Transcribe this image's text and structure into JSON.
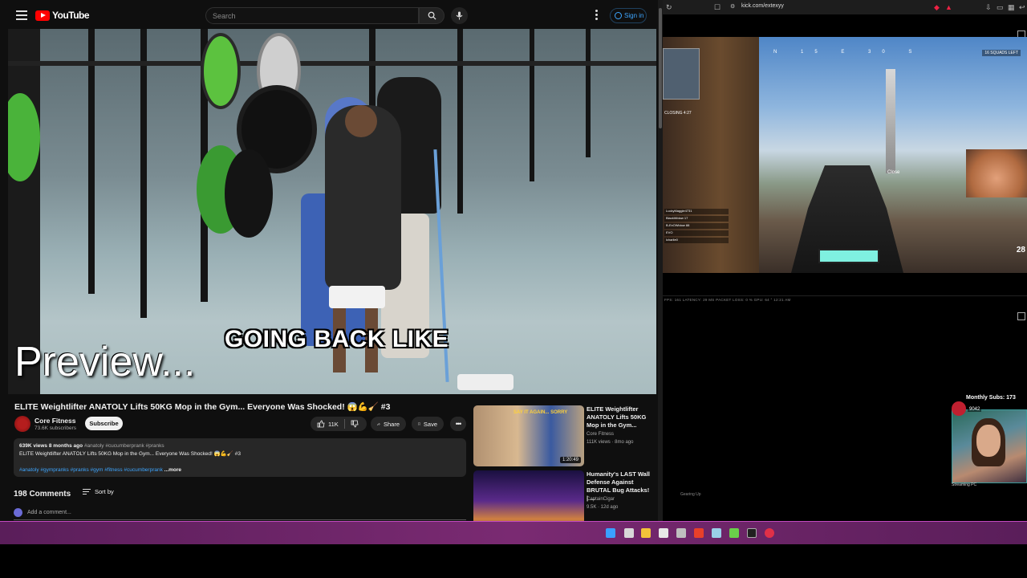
{
  "youtube": {
    "logo_text": "YouTube",
    "search_placeholder": "Search",
    "sign_in": "Sign in",
    "video": {
      "caption_main": "GOING BACK LIKE",
      "caption_preview": "Preview..."
    },
    "title": "ELITE Weightlifter ANATOLY Lifts 50KG Mop in the Gym... Everyone Was Shocked! 😱💪🧹 #3",
    "channel": {
      "name": "Core Fitness",
      "subs": "73.6K subscribers",
      "subscribe": "Subscribe"
    },
    "actions": {
      "likes": "11K",
      "share": "Share",
      "save": "Save"
    },
    "description": {
      "views_date": "639K views  8 months ago",
      "tags_inline": "#anatoly #cucumberprank #pranks",
      "line2": "ELITE Weightlifter ANATOLY Lifts 50KG Mop in the Gym... Everyone Was Shocked! 😱💪🧹 #3",
      "hashtags": "#anatoly #gympranks #pranks #gym #fitness #cucumberprank",
      "more": "...more"
    },
    "comments": {
      "count": "198 Comments",
      "sort": "Sort by",
      "add": "Add a comment..."
    },
    "recommended": [
      {
        "title": "ELITE Weightlifter ANATOLY Lifts 50KG Mop in the Gym... ",
        "channel": "Core Fitness",
        "meta": "111K views · 8mo ago",
        "duration": "1:20:49",
        "thumb_text": "SAY IT AGAIN... SORRY"
      },
      {
        "title": "Humanity's LAST Wall Defense Against BRUTAL Bug Attacks! | ...",
        "channel": "CaptainCigar",
        "meta": "9.5K · 12d ago",
        "duration": ""
      }
    ]
  },
  "kick": {
    "url": "kick.com/extexyy",
    "game": {
      "compass": "N 15 E 30 S",
      "squads_left": "16 SQUADS LEFT",
      "closing": "CLOSING 4:27",
      "close_label": "Close",
      "team": [
        "LuckyMaggie4731",
        "BlackWidow 17",
        "B-ExOWidow 88",
        "EVO",
        "lcharlie0"
      ],
      "ammo": "28"
    },
    "stats": "FPS: 161  LATENCY: 29 MS  PACKET LOSS: 0 %  GPU: 64 °  12:21 AM",
    "gearing_up": "Gearing Up",
    "monthly_subs": "Monthly Subs: 173",
    "sub_count": "9042",
    "streaming_pc": "Streaming PC"
  },
  "colors": {
    "yt_bg": "#0f0f0f",
    "yt_red": "#ff0000",
    "link_blue": "#3ea6ff",
    "taskbar": "#7a2a72"
  }
}
